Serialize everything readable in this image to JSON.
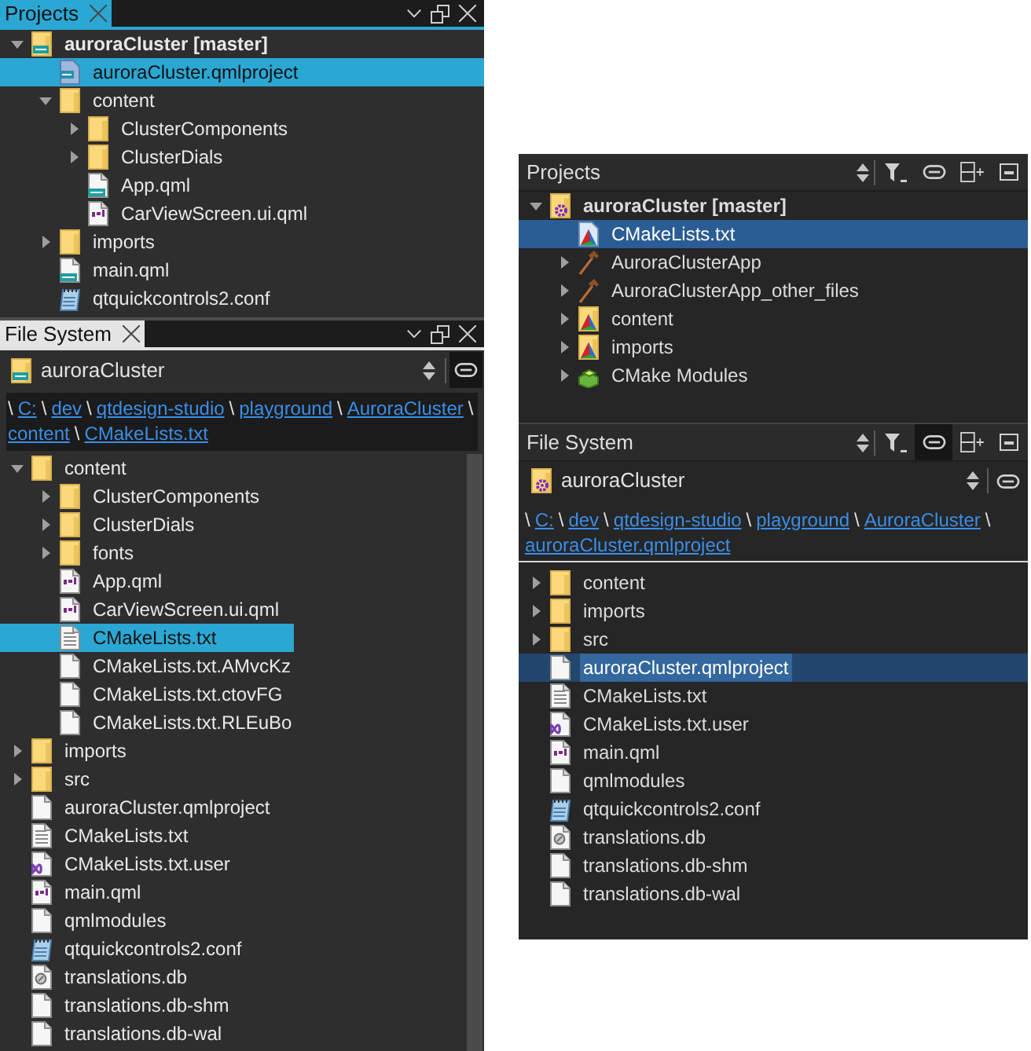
{
  "left_window": {
    "projects_pane": {
      "tab": {
        "label": "Projects",
        "active": true
      },
      "project": {
        "label": "auroraCluster [master]",
        "kind": "qmlfolder",
        "expanded": true,
        "selected": false,
        "children": [
          {
            "label": "auroraCluster.qmlproject",
            "kind": "qmlproject",
            "selected": true
          },
          {
            "label": "content",
            "kind": "folder",
            "expanded": true,
            "selected": false,
            "children": [
              {
                "label": "ClusterComponents",
                "kind": "folder",
                "expanded": false,
                "selected": false
              },
              {
                "label": "ClusterDials",
                "kind": "folder",
                "expanded": false,
                "selected": false
              },
              {
                "label": "App.qml",
                "kind": "qml",
                "selected": false
              },
              {
                "label": "CarViewScreen.ui.qml",
                "kind": "qmldoc",
                "selected": false
              }
            ]
          },
          {
            "label": "imports",
            "kind": "folder",
            "expanded": false,
            "selected": false
          },
          {
            "label": "main.qml",
            "kind": "qml",
            "selected": false
          },
          {
            "label": "qtquickcontrols2.conf",
            "kind": "notepad",
            "selected": false
          }
        ]
      }
    },
    "file_system_pane": {
      "tab": {
        "label": "File System",
        "active": false
      },
      "location": {
        "value": "auroraCluster",
        "kind": "qmlfolder",
        "link_checked": true
      },
      "breadcrumb": {
        "separator": "\\",
        "parts": [
          "C:",
          "dev",
          "qtdesign-studio",
          "playground",
          "AuroraCluster",
          "content",
          "CMakeLists.txt"
        ]
      },
      "tree": [
        {
          "label": "content",
          "kind": "folder",
          "expanded": true,
          "selected": false,
          "children": [
            {
              "label": "ClusterComponents",
              "kind": "folder",
              "expanded": false,
              "selected": false
            },
            {
              "label": "ClusterDials",
              "kind": "folder",
              "expanded": false,
              "selected": false
            },
            {
              "label": "fonts",
              "kind": "folder",
              "expanded": false,
              "selected": false
            },
            {
              "label": "App.qml",
              "kind": "qmldoc",
              "selected": false
            },
            {
              "label": "CarViewScreen.ui.qml",
              "kind": "qmldoc",
              "selected": false
            },
            {
              "label": "CMakeLists.txt",
              "kind": "text",
              "selected": true
            },
            {
              "label": "CMakeLists.txt.AMvcKz",
              "kind": "blank",
              "selected": false
            },
            {
              "label": "CMakeLists.txt.ctovFG",
              "kind": "blank",
              "selected": false
            },
            {
              "label": "CMakeLists.txt.RLEuBo",
              "kind": "blank",
              "selected": false
            }
          ]
        },
        {
          "label": "imports",
          "kind": "folder",
          "expanded": false,
          "selected": false
        },
        {
          "label": "src",
          "kind": "folder",
          "expanded": false,
          "selected": false
        },
        {
          "label": "auroraCluster.qmlproject",
          "kind": "blank",
          "selected": false
        },
        {
          "label": "CMakeLists.txt",
          "kind": "text",
          "selected": false
        },
        {
          "label": "CMakeLists.txt.user",
          "kind": "vsuser",
          "selected": false
        },
        {
          "label": "main.qml",
          "kind": "qmldoc",
          "selected": false
        },
        {
          "label": "qmlmodules",
          "kind": "blank",
          "selected": false
        },
        {
          "label": "qtquickcontrols2.conf",
          "kind": "notepad",
          "selected": false
        },
        {
          "label": "translations.db",
          "kind": "database",
          "selected": false
        },
        {
          "label": "translations.db-shm",
          "kind": "blank",
          "selected": false
        },
        {
          "label": "translations.db-wal",
          "kind": "blank",
          "selected": false
        }
      ]
    }
  },
  "right_window": {
    "projects_pane": {
      "title": "Projects",
      "link_checked": false,
      "project": {
        "label": "auroraCluster [master]",
        "kind": "gearfolder",
        "expanded": true,
        "selected": false,
        "children": [
          {
            "label": "CMakeLists.txt",
            "kind": "cmake",
            "selected": true
          },
          {
            "label": "AuroraClusterApp",
            "kind": "hammer",
            "expanded": false,
            "selected": false
          },
          {
            "label": "AuroraClusterApp_other_files",
            "kind": "hammer",
            "expanded": false,
            "selected": false
          },
          {
            "label": "content",
            "kind": "cmakefolder",
            "expanded": false,
            "selected": false
          },
          {
            "label": "imports",
            "kind": "cmakefolder",
            "expanded": false,
            "selected": false
          },
          {
            "label": "CMake Modules",
            "kind": "modules",
            "expanded": false,
            "selected": false
          }
        ]
      }
    },
    "file_system_pane": {
      "title": "File System",
      "link_checked": true,
      "location": {
        "value": "auroraCluster",
        "kind": "gearfolder",
        "link_checked": false
      },
      "breadcrumb": {
        "separator": "\\",
        "parts": [
          "C:",
          "dev",
          "qtdesign-studio",
          "playground",
          "AuroraCluster",
          "auroraCluster.qmlproject"
        ]
      },
      "tree": [
        {
          "label": "content",
          "kind": "folder",
          "expanded": false,
          "selected": false
        },
        {
          "label": "imports",
          "kind": "folder",
          "expanded": false,
          "selected": false
        },
        {
          "label": "src",
          "kind": "folder",
          "expanded": false,
          "selected": false
        },
        {
          "label": "auroraCluster.qmlproject",
          "kind": "blank",
          "selected": true
        },
        {
          "label": "CMakeLists.txt",
          "kind": "text",
          "selected": false
        },
        {
          "label": "CMakeLists.txt.user",
          "kind": "vsuser",
          "selected": false
        },
        {
          "label": "main.qml",
          "kind": "qmldoc",
          "selected": false
        },
        {
          "label": "qmlmodules",
          "kind": "blank",
          "selected": false
        },
        {
          "label": "qtquickcontrols2.conf",
          "kind": "notepad",
          "selected": false
        },
        {
          "label": "translations.db",
          "kind": "database",
          "selected": false
        },
        {
          "label": "translations.db-shm",
          "kind": "blank",
          "selected": false
        },
        {
          "label": "translations.db-wal",
          "kind": "blank",
          "selected": false
        }
      ]
    }
  }
}
